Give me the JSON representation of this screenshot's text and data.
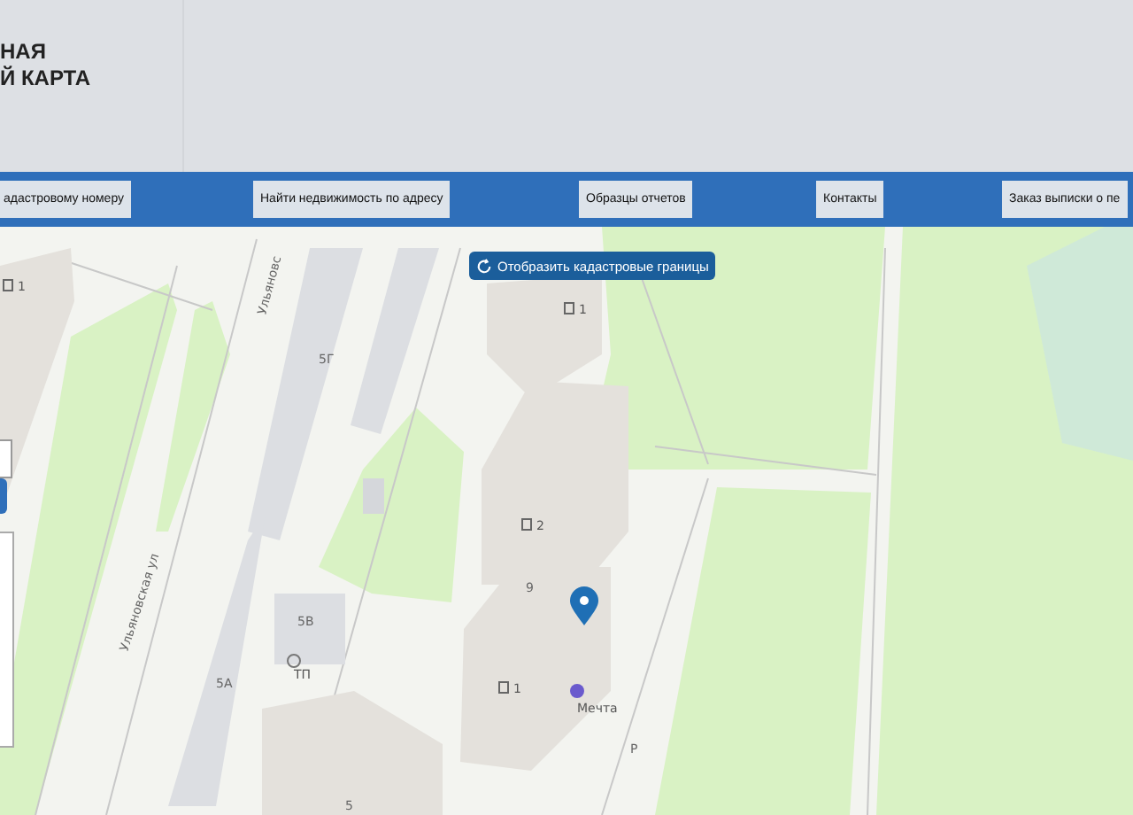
{
  "header": {
    "title_lines": [
      "НАЯ",
      "Й КАРТА"
    ]
  },
  "nav": {
    "buttons": [
      {
        "label": "адастровому номеру"
      },
      {
        "label": "Найти недвижимость по адресу"
      },
      {
        "label": "Образцы отчетов"
      },
      {
        "label": "Контакты"
      },
      {
        "label": "Заказ выписки о пе"
      }
    ]
  },
  "map": {
    "toggle_button": {
      "label": "Отобразить кадастровые границы"
    },
    "entrances": [
      "1",
      "1",
      "2",
      "1"
    ],
    "labels": [
      {
        "text": "5Г",
        "kind": "house"
      },
      {
        "text": "5В",
        "kind": "house"
      },
      {
        "text": "5А",
        "kind": "house"
      },
      {
        "text": "9",
        "kind": "house"
      },
      {
        "text": "5",
        "kind": "house"
      },
      {
        "text": "ТП",
        "kind": "poi"
      },
      {
        "text": "Мечта",
        "kind": "poi"
      },
      {
        "text": "Р",
        "kind": "house"
      },
      {
        "text": "Ульяновская ул",
        "kind": "street"
      },
      {
        "text": "Ульяновс",
        "kind": "street"
      }
    ]
  }
}
